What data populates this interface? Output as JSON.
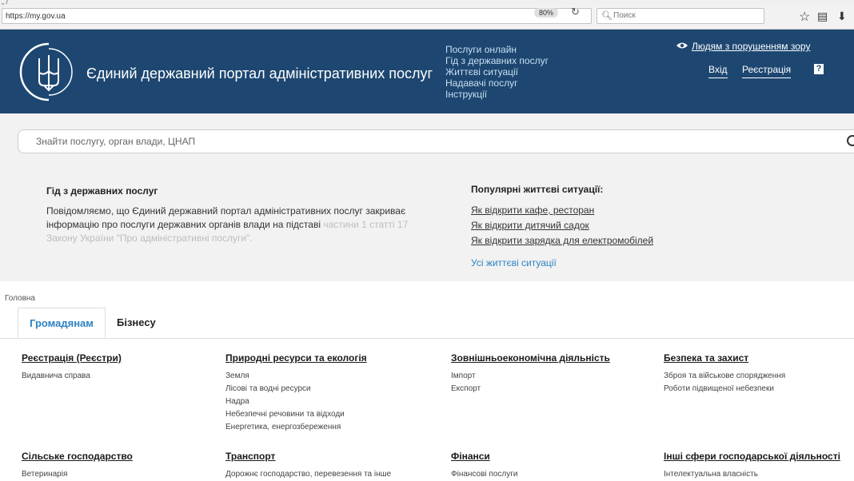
{
  "browser": {
    "url": "https://my.gov.ua",
    "zoom": "80%",
    "search_placeholder": "Поиск"
  },
  "header": {
    "site_title": "Єдиний державний портал адміністративних послуг",
    "nav": [
      "Послуги онлайн",
      "Гід з державних послуг",
      "Життєві ситуації",
      "Надавачі послуг",
      "Інструкції"
    ],
    "accessibility_link": "Людям з порушенням зору",
    "login": "Вхід",
    "register": "Реєстрація",
    "help": "?"
  },
  "search": {
    "placeholder": "Знайти послугу, орган влади, ЦНАП"
  },
  "info": {
    "guide_title": "Гід з державних послуг",
    "guide_text": "Повідомляємо, що Єдиний державний портал адміністративних послуг закриває інформацію про послуги державних органів влади на підставі",
    "guide_text_faded": "частини 1 статті 17 Закону України \"Про адміністративні послуги\".",
    "popular_title": "Популярні життєві ситуації:",
    "popular_links": [
      "Як відкрити кафе, ресторан",
      "Як відкрити дитячий садок",
      "Як відкрити зарядка для електромобілей"
    ],
    "all_situations": "Усі життєві ситуації"
  },
  "breadcrumb": "Головна",
  "tabs": [
    "Громадянам",
    "Бізнесу"
  ],
  "categories": [
    {
      "title": "Реєстрація (Реєстри)",
      "items": [
        "Видавнича справа"
      ]
    },
    {
      "title": "Природні ресурси та екологія",
      "items": [
        "Земля",
        "Лісові та водні ресурси",
        "Надра",
        "Небезпечні речовини та відходи",
        "Енергетика, енергозбереження"
      ]
    },
    {
      "title": "Зовнішньоекономічна діяльність",
      "items": [
        "Імпорт",
        "Експорт"
      ]
    },
    {
      "title": "Безпека та захист",
      "items": [
        "Зброя та військове спорядження",
        "Роботи підвищеної небезпеки"
      ]
    },
    {
      "title": "Сільське господарство",
      "items": [
        "Ветеринарія"
      ]
    },
    {
      "title": "Транспорт",
      "items": [
        "Дорожнє господарство, перевезення та інше"
      ]
    },
    {
      "title": "Фінанси",
      "items": [
        "Фінансові послуги"
      ]
    },
    {
      "title": "Інші сфери господарської діяльності",
      "items": [
        "Інтелектуальна власність"
      ]
    }
  ],
  "colors": {
    "header_bg": "#1d4771",
    "accent": "#2d82c3",
    "page_bg": "#f2f2f2"
  }
}
